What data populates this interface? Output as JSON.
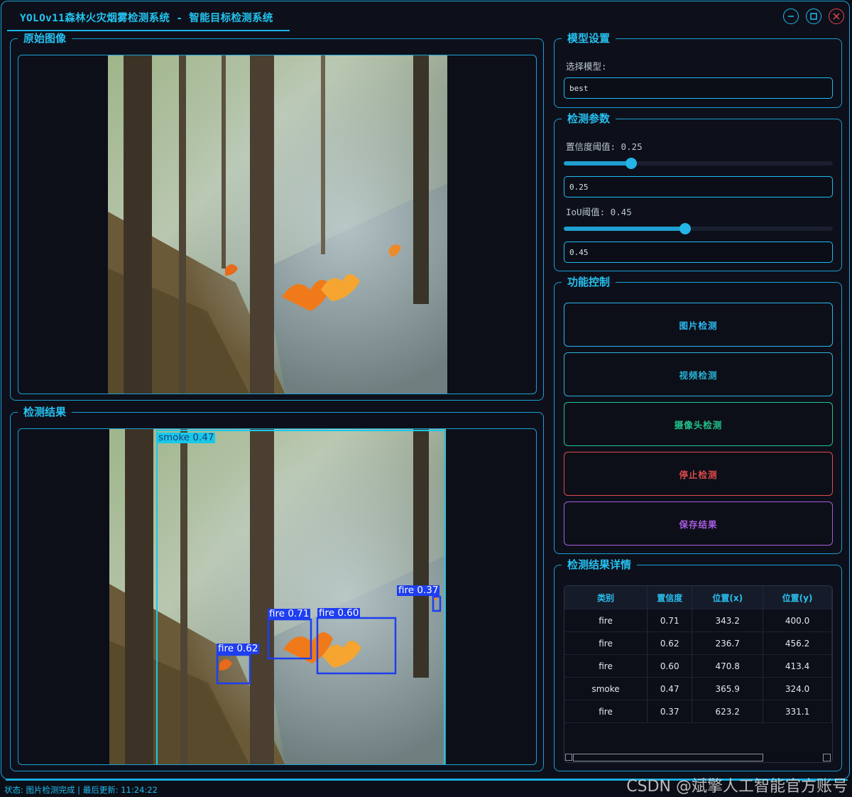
{
  "window": {
    "title": "YOLOv11森林火灾烟雾检测系统 - 智能目标检测系统",
    "controls": [
      "minimize-icon",
      "maximize-icon",
      "close-icon"
    ]
  },
  "original_panel": {
    "title": "原始图像"
  },
  "result_panel": {
    "title": "检测结果"
  },
  "detections": [
    {
      "label": "smoke 0.47",
      "color": "#19c8e8"
    },
    {
      "label": "fire 0.71",
      "color": "#1e3ef0"
    },
    {
      "label": "fire 0.60",
      "color": "#1e3ef0"
    },
    {
      "label": "fire 0.62",
      "color": "#1e3ef0"
    },
    {
      "label": "fire 0.37",
      "color": "#1e3ef0"
    }
  ],
  "model_settings": {
    "title": "模型设置",
    "select_label": "选择模型:",
    "selected_model": "best"
  },
  "params": {
    "title": "检测参数",
    "confidence_label": "置信度阈值: 0.25",
    "confidence_value": "0.25",
    "confidence_fraction": 0.25,
    "iou_label": "IoU阈值: 0.45",
    "iou_value": "0.45",
    "iou_fraction": 0.45
  },
  "controls": {
    "title": "功能控制",
    "buttons": [
      {
        "label": "图片检测",
        "color": "#2ab8f0"
      },
      {
        "label": "视频检测",
        "color": "#27b2d6"
      },
      {
        "label": "摄像头检测",
        "color": "#20c48a"
      },
      {
        "label": "停止检测",
        "color": "#e04a4a"
      },
      {
        "label": "保存结果",
        "color": "#a85ae0"
      }
    ]
  },
  "details": {
    "title": "检测结果详情",
    "columns": [
      "类别",
      "置信度",
      "位置(x)",
      "位置(y)"
    ],
    "rows": [
      [
        "fire",
        "0.71",
        "343.2",
        "400.0"
      ],
      [
        "fire",
        "0.62",
        "236.7",
        "456.2"
      ],
      [
        "fire",
        "0.60",
        "470.8",
        "413.4"
      ],
      [
        "smoke",
        "0.47",
        "365.9",
        "324.0"
      ],
      [
        "fire",
        "0.37",
        "623.2",
        "331.1"
      ]
    ]
  },
  "status_bar": {
    "text": "状态: 图片检测完成 | 最后更新: 11:24:22"
  },
  "watermark": {
    "text": "CSDN @斌擎人工智能官方账号"
  }
}
